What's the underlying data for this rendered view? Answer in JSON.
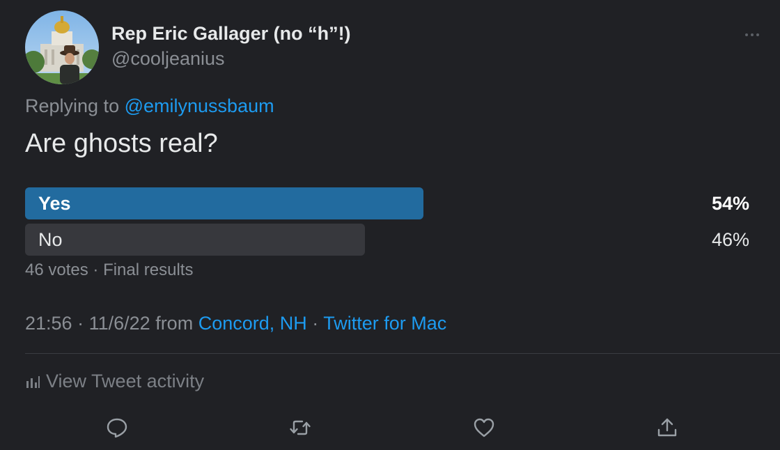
{
  "tweet": {
    "author": {
      "display_name": "Rep Eric Gallager (no “h”!)",
      "handle": "@cooljeanius",
      "avatar_icon": "profile-photo"
    },
    "reply": {
      "prefix": "Replying to",
      "mention": "@emilynussbaum"
    },
    "text": "Are ghosts real?",
    "poll": {
      "options": [
        {
          "label": "Yes",
          "percent_text": "54%",
          "share": 0.54,
          "winner": true
        },
        {
          "label": "No",
          "percent_text": "46%",
          "share": 0.46,
          "winner": false
        }
      ],
      "votes": "46 votes",
      "separator": " · ",
      "status": "Final results"
    },
    "meta": {
      "time": "21:56",
      "date": "11/6/22",
      "from_word": "from",
      "location": "Concord, NH",
      "source": "Twitter for Mac",
      "separator": " · "
    },
    "activity_label": "View Tweet activity",
    "actions": [
      {
        "name": "reply-icon"
      },
      {
        "name": "retweet-icon"
      },
      {
        "name": "like-icon"
      },
      {
        "name": "share-icon"
      }
    ]
  },
  "colors": {
    "background": "#202125",
    "accent": "#1d9bf0",
    "poll_winner": "#226b9f",
    "poll_other": "#37383d",
    "secondary_text": "#8b8f95"
  }
}
